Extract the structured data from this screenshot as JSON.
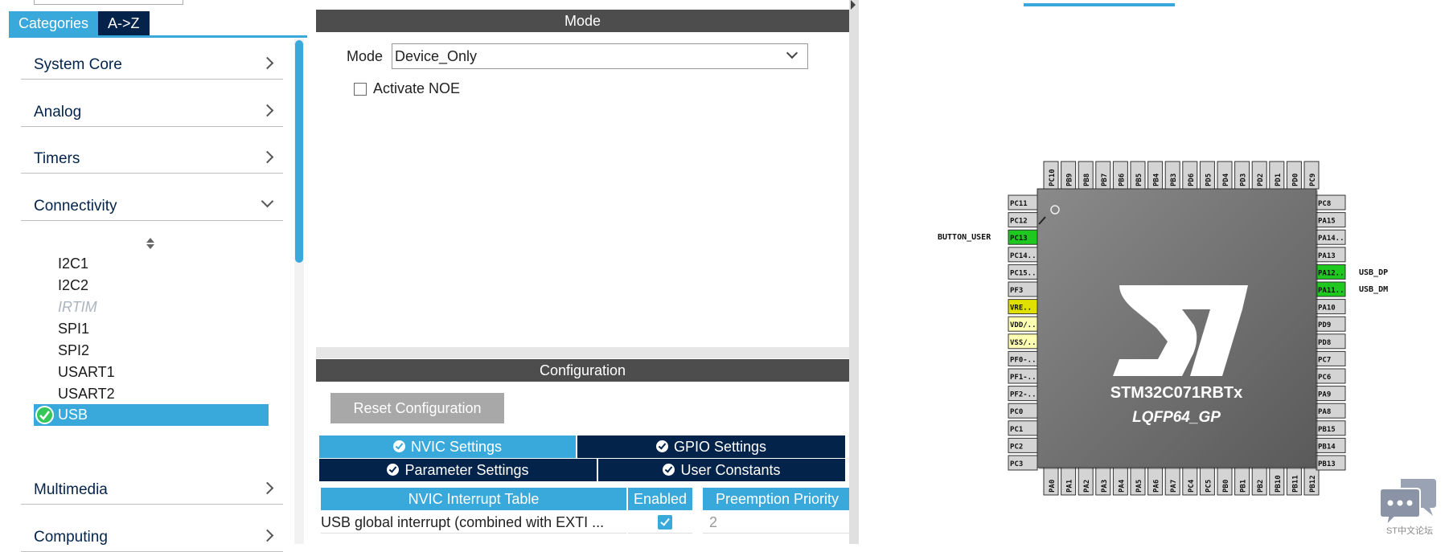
{
  "left": {
    "tabs": [
      {
        "label": "Categories"
      },
      {
        "label": "A->Z"
      }
    ],
    "categories": {
      "system_core": "System Core",
      "analog": "Analog",
      "timers": "Timers",
      "connectivity": "Connectivity",
      "multimedia": "Multimedia",
      "computing": "Computing"
    },
    "connectivity_items": [
      "I2C1",
      "I2C2",
      "IRTIM",
      "SPI1",
      "SPI2",
      "USART1",
      "USART2"
    ],
    "selected_item": "USB"
  },
  "mode_panel": {
    "header": "Mode",
    "mode_label": "Mode",
    "mode_value": "Device_Only",
    "noe_label": "Activate NOE"
  },
  "config_panel": {
    "header": "Configuration",
    "reset_label": "Reset Configuration",
    "tabs": {
      "nvic": "NVIC Settings",
      "gpio": "GPIO Settings",
      "param": "Parameter Settings",
      "user": "User Constants"
    },
    "table": {
      "columns": [
        "NVIC Interrupt Table",
        "Enabled",
        "Preemption Priority"
      ],
      "rows": [
        {
          "name": "USB global interrupt (combined with EXTI ...",
          "enabled": true,
          "priority": "2"
        }
      ]
    }
  },
  "chip": {
    "name": "STM32C071RBTx",
    "package": "LQFP64_GP",
    "top_pins": [
      "PC10",
      "PB9",
      "PB8",
      "PB7",
      "PB6",
      "PB5",
      "PB4",
      "PB3",
      "PD6",
      "PD5",
      "PD4",
      "PD3",
      "PD2",
      "PD1",
      "PD0",
      "PC9"
    ],
    "bottom_pins": [
      "PA0",
      "PA1",
      "PA2",
      "PA3",
      "PA4",
      "PA5",
      "PA6",
      "PA7",
      "PC4",
      "PC5",
      "PB0",
      "PB1",
      "PB2",
      "PB10",
      "PB11",
      "PB12"
    ],
    "left_pins": [
      "PC11",
      "PC12",
      "PC13",
      "PC14..",
      "PC15..",
      "PF3",
      "VRE..",
      "VDD/..",
      "VSS/..",
      "PF0-..",
      "PF1-..",
      "PF2-..",
      "PC0",
      "PC1",
      "PC2",
      "PC3"
    ],
    "right_pins": [
      "PC8",
      "PA15",
      "PA14..",
      "PA13",
      "PA12..",
      "PA11..",
      "PA10",
      "PD9",
      "PD8",
      "PC7",
      "PC6",
      "PA9",
      "PA8",
      "PB15",
      "PB14",
      "PB13"
    ],
    "signal_labels": {
      "button_user": "BUTTON_USER",
      "usb_dp": "USB_DP",
      "usb_dm": "USB_DM"
    },
    "colors": {
      "gpio_assigned": "#1ec81e",
      "power_yellow": "#e1e100",
      "power_light": "#ffffb4"
    }
  },
  "forum_label": "ST中文论坛"
}
